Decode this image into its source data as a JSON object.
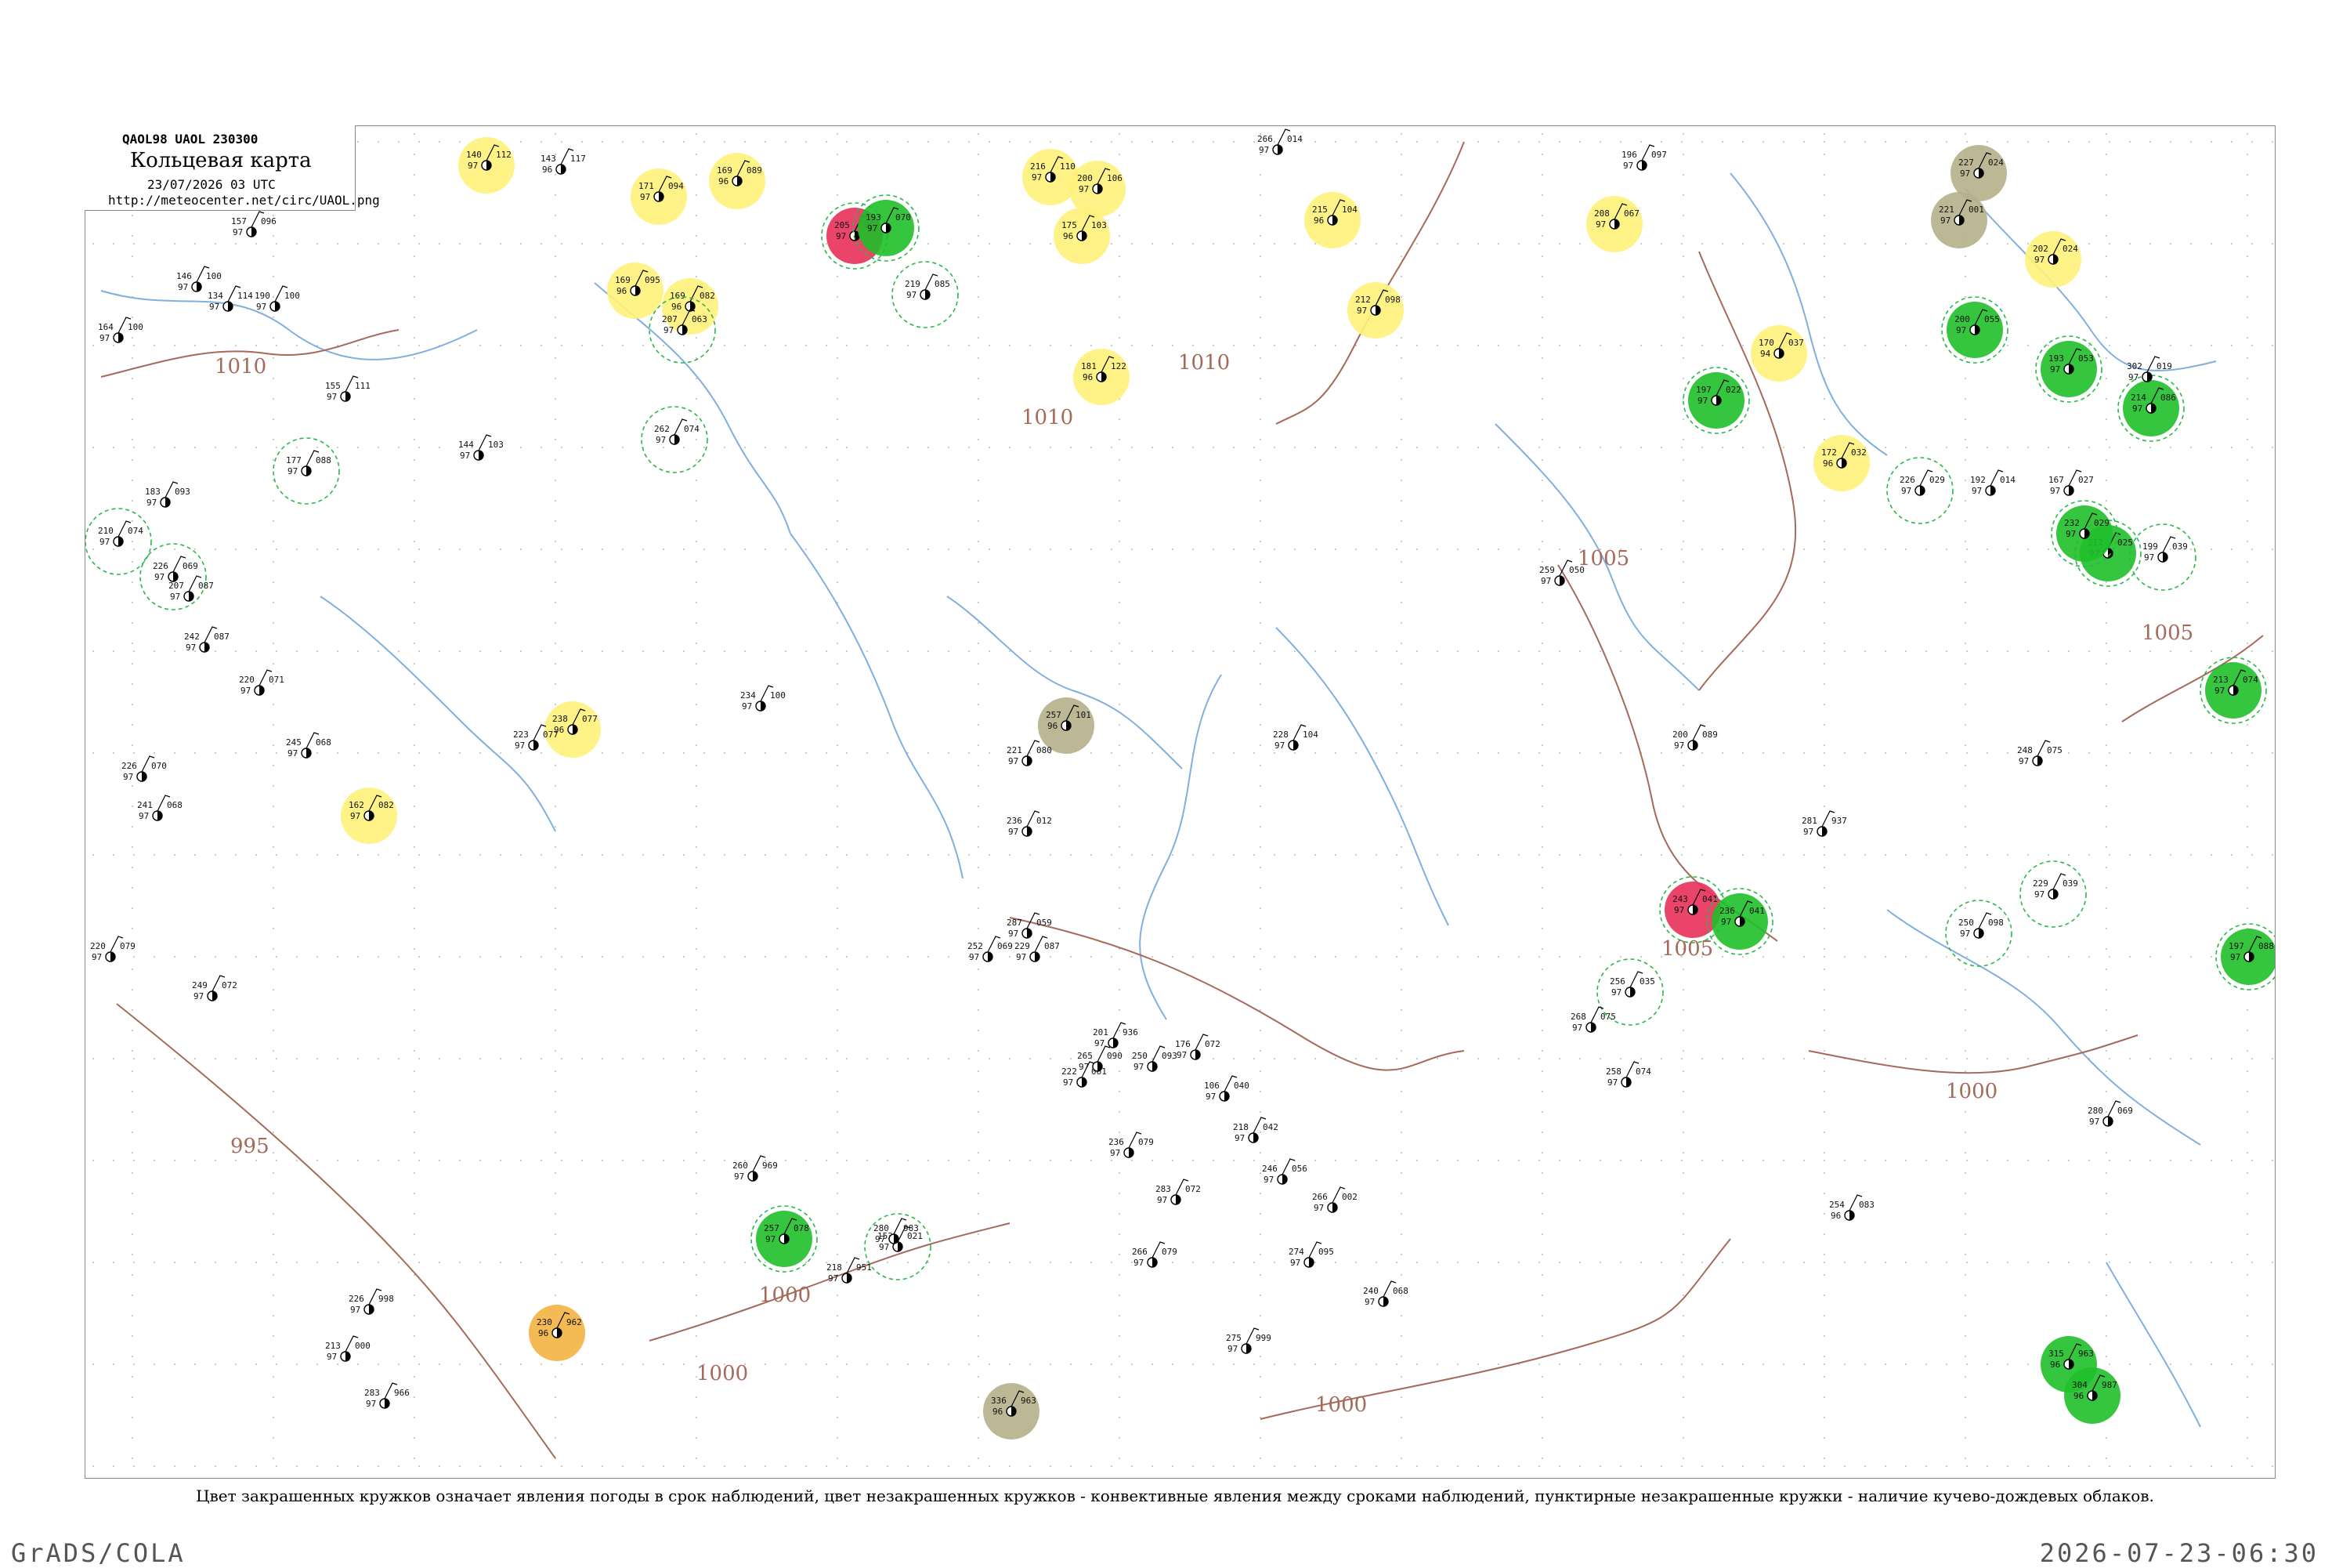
{
  "legend": {
    "code_line": "QAOL98  UAOL  230300",
    "title": "Кольцевая карта",
    "date": "23/07/2026 03 UTC",
    "url": "http://meteocenter.net/circ/UAOL.png"
  },
  "caption": "Цвет закрашенных кружков означает явления погоды в срок наблюдений, цвет незакрашенных кружков - конвективные явления между сроками наблюдений, пунктирные незакрашенные кружки - наличие кучево-дождевых облаков.",
  "footer": {
    "left": "GrADS/COLA",
    "right": "2026-07-23-06:30"
  },
  "colors": {
    "isobar": "#a56a5a",
    "river": "#7fb0e0",
    "yellow": "#fff27a",
    "green": "#1fbf2a",
    "red": "#e8305a",
    "olive": "#b5b08a",
    "orange": "#f3b340",
    "cb_dashed": "#2bb84a"
  },
  "isobars": [
    {
      "label": "1010"
    },
    {
      "label": "1010"
    },
    {
      "label": "1010"
    },
    {
      "label": "1005"
    },
    {
      "label": "1005"
    },
    {
      "label": "1005"
    },
    {
      "label": "1000"
    },
    {
      "label": "1000"
    },
    {
      "label": "1000"
    },
    {
      "label": "995"
    },
    {
      "label": "1000"
    }
  ],
  "stations": [
    {
      "t": "140",
      "d": "112",
      "p": "97",
      "f": "yellow",
      "cb": false
    },
    {
      "t": "171",
      "d": "094",
      "p": "97",
      "f": "yellow",
      "cb": false
    },
    {
      "t": "169",
      "d": "089",
      "p": "96",
      "f": "yellow",
      "cb": false
    },
    {
      "t": "169",
      "d": "082",
      "p": "96",
      "f": "yellow",
      "cb": false
    },
    {
      "t": "205",
      "d": "067",
      "p": "97",
      "f": "red",
      "cb": true
    },
    {
      "t": "193",
      "d": "070",
      "p": "97",
      "f": "green",
      "cb": true
    },
    {
      "t": "216",
      "d": "110",
      "p": "97",
      "f": "yellow",
      "cb": false
    },
    {
      "t": "200",
      "d": "106",
      "p": "97",
      "f": "yellow",
      "cb": false
    },
    {
      "t": "175",
      "d": "103",
      "p": "96",
      "f": "yellow",
      "cb": false
    },
    {
      "t": "215",
      "d": "104",
      "p": "96",
      "f": "yellow",
      "cb": false
    },
    {
      "t": "212",
      "d": "098",
      "p": "97",
      "f": "yellow",
      "cb": false
    },
    {
      "t": "181",
      "d": "122",
      "p": "96",
      "f": "yellow",
      "cb": false
    },
    {
      "t": "169",
      "d": "095",
      "p": "96",
      "f": "yellow",
      "cb": false
    },
    {
      "t": "162",
      "d": "082",
      "p": "97",
      "f": "yellow",
      "cb": false
    },
    {
      "t": "238",
      "d": "077",
      "p": "96",
      "f": "yellow",
      "cb": false
    },
    {
      "t": "257",
      "d": "101",
      "p": "96",
      "f": "olive",
      "cb": false
    },
    {
      "t": "227",
      "d": "024",
      "p": "97",
      "f": "olive",
      "cb": false
    },
    {
      "t": "221",
      "d": "001",
      "p": "97",
      "f": "olive",
      "cb": false
    },
    {
      "t": "208",
      "d": "067",
      "p": "97",
      "f": "yellow",
      "cb": false
    },
    {
      "t": "202",
      "d": "024",
      "p": "97",
      "f": "yellow",
      "cb": false
    },
    {
      "t": "172",
      "d": "032",
      "p": "96",
      "f": "yellow",
      "cb": false
    },
    {
      "t": "170",
      "d": "037",
      "p": "94",
      "f": "yellow",
      "cb": false
    },
    {
      "t": "200",
      "d": "055",
      "p": "97",
      "f": "green",
      "cb": true
    },
    {
      "t": "193",
      "d": "053",
      "p": "97",
      "f": "green",
      "cb": true
    },
    {
      "t": "197",
      "d": "022",
      "p": "97",
      "f": "green",
      "cb": true
    },
    {
      "t": "212",
      "d": "025",
      "p": "97",
      "f": "green",
      "cb": true
    },
    {
      "t": "213",
      "d": "074",
      "p": "97",
      "f": "green",
      "cb": true
    },
    {
      "t": "232",
      "d": "029",
      "p": "97",
      "f": "green",
      "cb": true
    },
    {
      "t": "214",
      "d": "086",
      "p": "97",
      "f": "green",
      "cb": true
    },
    {
      "t": "243",
      "d": "041",
      "p": "97",
      "f": "red",
      "cb": true
    },
    {
      "t": "236",
      "d": "041",
      "p": "97",
      "f": "green",
      "cb": true
    },
    {
      "t": "197",
      "d": "088",
      "p": "97",
      "f": "green",
      "cb": true
    },
    {
      "t": "257",
      "d": "078",
      "p": "97",
      "f": "green",
      "cb": true
    },
    {
      "t": "230",
      "d": "962",
      "p": "96",
      "f": "orange",
      "cb": false
    },
    {
      "t": "336",
      "d": "963",
      "p": "96",
      "f": "olive",
      "cb": false
    },
    {
      "t": "315",
      "d": "963",
      "p": "96",
      "f": "green",
      "cb": false
    },
    {
      "t": "304",
      "d": "987",
      "p": "96",
      "f": "green",
      "cb": false
    },
    {
      "t": "210",
      "d": "074",
      "p": "97",
      "f": "none",
      "cb": true
    },
    {
      "t": "226",
      "d": "069",
      "p": "97",
      "f": "none",
      "cb": true
    },
    {
      "t": "177",
      "d": "088",
      "p": "97",
      "f": "none",
      "cb": true
    },
    {
      "t": "262",
      "d": "074",
      "p": "97",
      "f": "none",
      "cb": true
    },
    {
      "t": "207",
      "d": "063",
      "p": "97",
      "f": "none",
      "cb": true
    },
    {
      "t": "219",
      "d": "085",
      "p": "97",
      "f": "none",
      "cb": true
    },
    {
      "t": "229",
      "d": "039",
      "p": "97",
      "f": "none",
      "cb": true
    },
    {
      "t": "256",
      "d": "035",
      "p": "97",
      "f": "none",
      "cb": true
    },
    {
      "t": "153",
      "d": "021",
      "p": "97",
      "f": "none",
      "cb": true
    },
    {
      "t": "250",
      "d": "098",
      "p": "97",
      "f": "none",
      "cb": true
    },
    {
      "t": "199",
      "d": "039",
      "p": "97",
      "f": "none",
      "cb": true
    },
    {
      "t": "226",
      "d": "029",
      "p": "97",
      "f": "none",
      "cb": true
    },
    {
      "t": "192",
      "d": "014",
      "p": "97",
      "f": "none",
      "cb": false
    },
    {
      "t": "167",
      "d": "027",
      "p": "97",
      "f": "none",
      "cb": false
    },
    {
      "t": "217",
      "d": "022",
      "p": "97",
      "f": "none",
      "cb": false
    },
    {
      "t": "143",
      "d": "117",
      "p": "96",
      "f": "none",
      "cb": false
    },
    {
      "t": "157",
      "d": "096",
      "p": "97",
      "f": "none",
      "cb": false
    },
    {
      "t": "146",
      "d": "100",
      "p": "97",
      "f": "none",
      "cb": false
    },
    {
      "t": "164",
      "d": "100",
      "p": "97",
      "f": "none",
      "cb": false
    },
    {
      "t": "134",
      "d": "114",
      "p": "97",
      "f": "none",
      "cb": false
    },
    {
      "t": "190",
      "d": "100",
      "p": "97",
      "f": "none",
      "cb": false
    },
    {
      "t": "155",
      "d": "111",
      "p": "97",
      "f": "none",
      "cb": false
    },
    {
      "t": "144",
      "d": "103",
      "p": "97",
      "f": "none",
      "cb": false
    },
    {
      "t": "183",
      "d": "093",
      "p": "97",
      "f": "none",
      "cb": false
    },
    {
      "t": "207",
      "d": "087",
      "p": "97",
      "f": "none",
      "cb": false
    },
    {
      "t": "242",
      "d": "087",
      "p": "97",
      "f": "none",
      "cb": false
    },
    {
      "t": "220",
      "d": "071",
      "p": "97",
      "f": "none",
      "cb": false
    },
    {
      "t": "226",
      "d": "070",
      "p": "97",
      "f": "none",
      "cb": false
    },
    {
      "t": "241",
      "d": "068",
      "p": "97",
      "f": "none",
      "cb": false
    },
    {
      "t": "220",
      "d": "079",
      "p": "97",
      "f": "none",
      "cb": false
    },
    {
      "t": "249",
      "d": "072",
      "p": "97",
      "f": "none",
      "cb": false
    },
    {
      "t": "226",
      "d": "998",
      "p": "97",
      "f": "none",
      "cb": false
    },
    {
      "t": "213",
      "d": "000",
      "p": "97",
      "f": "none",
      "cb": false
    },
    {
      "t": "283",
      "d": "966",
      "p": "97",
      "f": "none",
      "cb": false
    },
    {
      "t": "260",
      "d": "969",
      "p": "97",
      "f": "none",
      "cb": false
    },
    {
      "t": "218",
      "d": "951",
      "p": "97",
      "f": "none",
      "cb": false
    },
    {
      "t": "280",
      "d": "983",
      "p": "97",
      "f": "none",
      "cb": false
    },
    {
      "t": "201",
      "d": "936",
      "p": "97",
      "f": "none",
      "cb": false
    },
    {
      "t": "250",
      "d": "093",
      "p": "97",
      "f": "none",
      "cb": false
    },
    {
      "t": "275",
      "d": "999",
      "p": "97",
      "f": "none",
      "cb": false
    },
    {
      "t": "266",
      "d": "002",
      "p": "97",
      "f": "none",
      "cb": false
    },
    {
      "t": "240",
      "d": "068",
      "p": "97",
      "f": "none",
      "cb": false
    },
    {
      "t": "268",
      "d": "075",
      "p": "97",
      "f": "none",
      "cb": false
    },
    {
      "t": "258",
      "d": "074",
      "p": "97",
      "f": "none",
      "cb": false
    },
    {
      "t": "254",
      "d": "083",
      "p": "96",
      "f": "none",
      "cb": false
    },
    {
      "t": "280",
      "d": "069",
      "p": "97",
      "f": "none",
      "cb": false
    },
    {
      "t": "302",
      "d": "019",
      "p": "97",
      "f": "none",
      "cb": false
    },
    {
      "t": "266",
      "d": "014",
      "p": "97",
      "f": "none",
      "cb": false
    },
    {
      "t": "196",
      "d": "097",
      "p": "97",
      "f": "none",
      "cb": false
    },
    {
      "t": "281",
      "d": "937",
      "p": "97",
      "f": "none",
      "cb": false
    },
    {
      "t": "236",
      "d": "012",
      "p": "97",
      "f": "none",
      "cb": false
    },
    {
      "t": "228",
      "d": "104",
      "p": "97",
      "f": "none",
      "cb": false
    },
    {
      "t": "222",
      "d": "061",
      "p": "97",
      "f": "none",
      "cb": false
    },
    {
      "t": "245",
      "d": "068",
      "p": "97",
      "f": "none",
      "cb": false
    },
    {
      "t": "234",
      "d": "100",
      "p": "97",
      "f": "none",
      "cb": false
    },
    {
      "t": "223",
      "d": "077",
      "p": "97",
      "f": "none",
      "cb": false
    },
    {
      "t": "229",
      "d": "087",
      "p": "97",
      "f": "none",
      "cb": false
    },
    {
      "t": "252",
      "d": "069",
      "p": "97",
      "f": "none",
      "cb": false
    },
    {
      "t": "287",
      "d": "059",
      "p": "97",
      "f": "none",
      "cb": false
    },
    {
      "t": "236",
      "d": "079",
      "p": "97",
      "f": "none",
      "cb": false
    },
    {
      "t": "265",
      "d": "090",
      "p": "97",
      "f": "none",
      "cb": false
    },
    {
      "t": "274",
      "d": "095",
      "p": "97",
      "f": "none",
      "cb": false
    },
    {
      "t": "283",
      "d": "072",
      "p": "97",
      "f": "none",
      "cb": false
    },
    {
      "t": "266",
      "d": "079",
      "p": "97",
      "f": "none",
      "cb": false
    },
    {
      "t": "221",
      "d": "080",
      "p": "97",
      "f": "none",
      "cb": false
    },
    {
      "t": "259",
      "d": "050",
      "p": "97",
      "f": "none",
      "cb": false
    },
    {
      "t": "248",
      "d": "075",
      "p": "97",
      "f": "none",
      "cb": false
    },
    {
      "t": "200",
      "d": "089",
      "p": "97",
      "f": "none",
      "cb": false
    },
    {
      "t": "176",
      "d": "072",
      "p": "97",
      "f": "none",
      "cb": false
    },
    {
      "t": "106",
      "d": "040",
      "p": "97",
      "f": "none",
      "cb": false
    },
    {
      "t": "218",
      "d": "042",
      "p": "97",
      "f": "none",
      "cb": false
    },
    {
      "t": "246",
      "d": "056",
      "p": "97",
      "f": "none",
      "cb": false
    }
  ]
}
